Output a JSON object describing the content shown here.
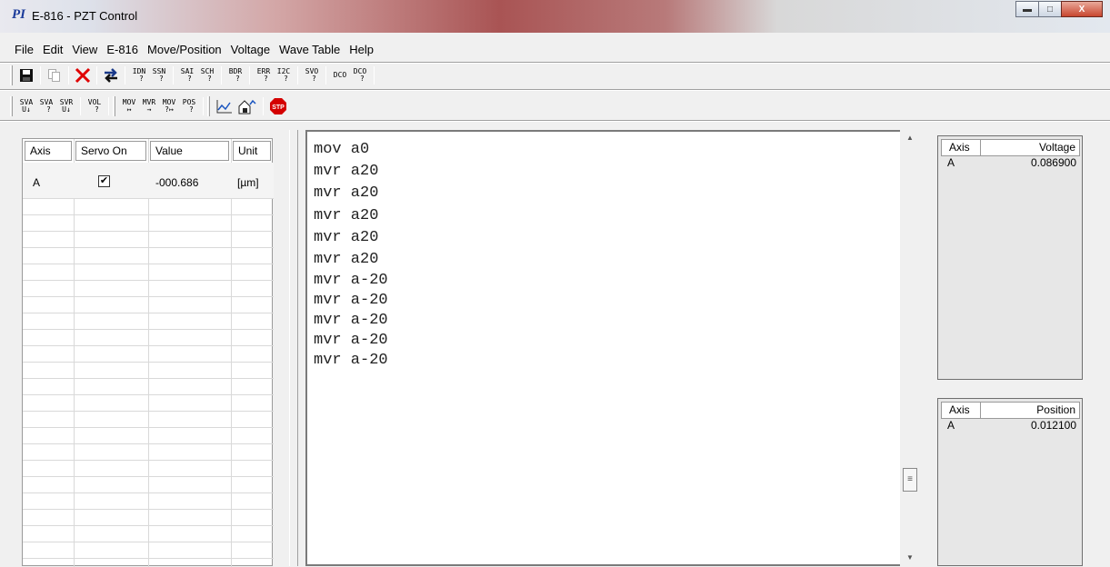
{
  "window": {
    "logo": "PI",
    "title": "E-816 - PZT Control"
  },
  "menu": [
    "File",
    "Edit",
    "View",
    "E-816",
    "Move/Position",
    "Voltage",
    "Wave Table",
    "Help"
  ],
  "toolbar1": {
    "idn": "IDN\n ?",
    "ssn": "SSN\n ?",
    "sai": "SAI\n ?",
    "sch": "SCH\n ?",
    "bdr": "BDR\n ?",
    "err": "ERR\n ?",
    "i2c": "I2C\n ?",
    "svo": "SVO\n ?",
    "dco1": "DCO",
    "dco2": "DCO\n ?"
  },
  "toolbar2": {
    "sva1": "SVA\nU↓",
    "sva2": "SVA\n ?",
    "svr": "SVR\nU↓",
    "vol": "VOL\n ?",
    "mov1": "MOV\n↦",
    "mvr": "MVR\n→",
    "mov2": "MOV\n?↦",
    "pos": "POS\n ?",
    "stop": "STP"
  },
  "axis_table": {
    "headers": [
      "Axis",
      "Servo On",
      "Value",
      "Unit"
    ],
    "rows": [
      {
        "axis": "A",
        "servo_on": true,
        "servo_mark": "✔",
        "value": "-000.686",
        "unit": "[µm]"
      }
    ]
  },
  "editor": {
    "lines": [
      "mov a0",
      "mvr a20",
      "mvr a20",
      "mvr a20",
      "mvr a20",
      "mvr a20",
      "mvr a-20",
      "mvr a-20",
      "mvr a-20",
      "mvr a-20",
      "mvr a-20"
    ]
  },
  "voltage_table": {
    "headers": [
      "Axis",
      "Voltage"
    ],
    "rows": [
      {
        "axis": "A",
        "value": "0.086900"
      }
    ]
  },
  "position_table": {
    "headers": [
      "Axis",
      "Position"
    ],
    "rows": [
      {
        "axis": "A",
        "value": "0.012100"
      }
    ]
  }
}
